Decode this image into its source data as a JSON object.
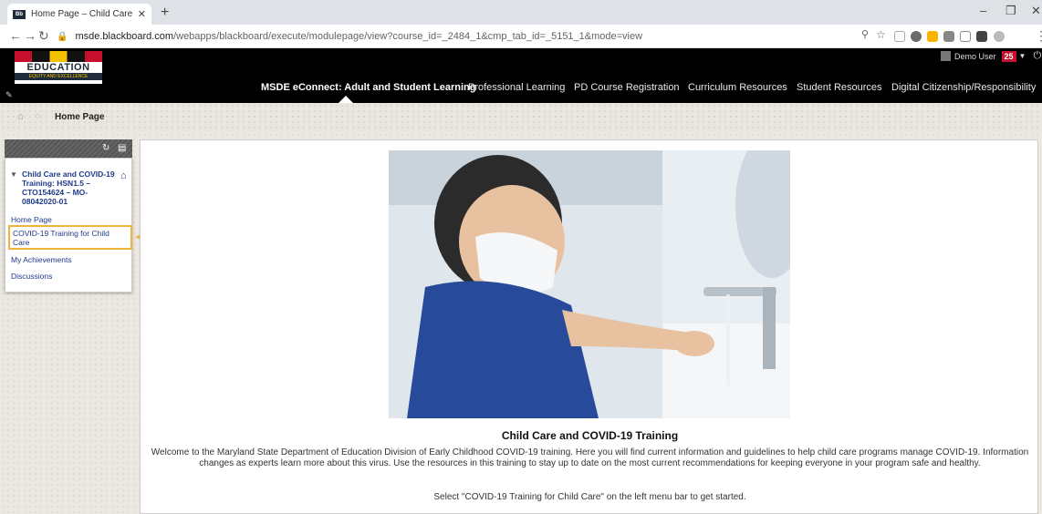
{
  "browser": {
    "tab_title": "Home Page – Child Care and CO",
    "tab_favicon": "Bb",
    "new_tab": "+",
    "url_host": "msde.blackboard.com",
    "url_path": "/webapps/blackboard/execute/modulepage/view?course_id=_2484_1&cmp_tab_id=_5151_1&mode=view"
  },
  "site": {
    "logo_text": "EDUCATION",
    "logo_sub": "EQUITY AND EXCELLENCE",
    "nav": [
      "MSDE eConnect: Adult and Student Learning",
      "Professional Learning",
      "PD Course Registration",
      "Curriculum Resources",
      "Student Resources",
      "Digital Citizenship/Responsibility"
    ],
    "user_name": "Demo User",
    "notification_count": "25"
  },
  "breadcrumb": {
    "current": "Home Page"
  },
  "course_menu": {
    "course_title": "Child Care and COVID-19 Training: HSN1.5 – CTO154624 – MO-08042020-01",
    "items": [
      "Home Page",
      "COVID-19 Training for Child Care",
      "My Achievements",
      "Discussions"
    ]
  },
  "content": {
    "heading": "Child Care and COVID-19 Training",
    "paragraph": "Welcome to the Maryland State Department of Education Division of Early Childhood COVID-19 training. Here you will find current information and guidelines to help child care programs manage COVID-19. Information changes as experts learn more about this virus. Use the resources in this training to stay up to date on the most current recommendations for keeping everyone in your program safe and healthy.",
    "instruction": "Select \"COVID-19 Training for Child Care\" on the left menu bar to get started."
  },
  "colors": {
    "accent_highlight": "#f0b43c",
    "menu_link": "#1f3a8a",
    "header_bg": "#000000"
  }
}
